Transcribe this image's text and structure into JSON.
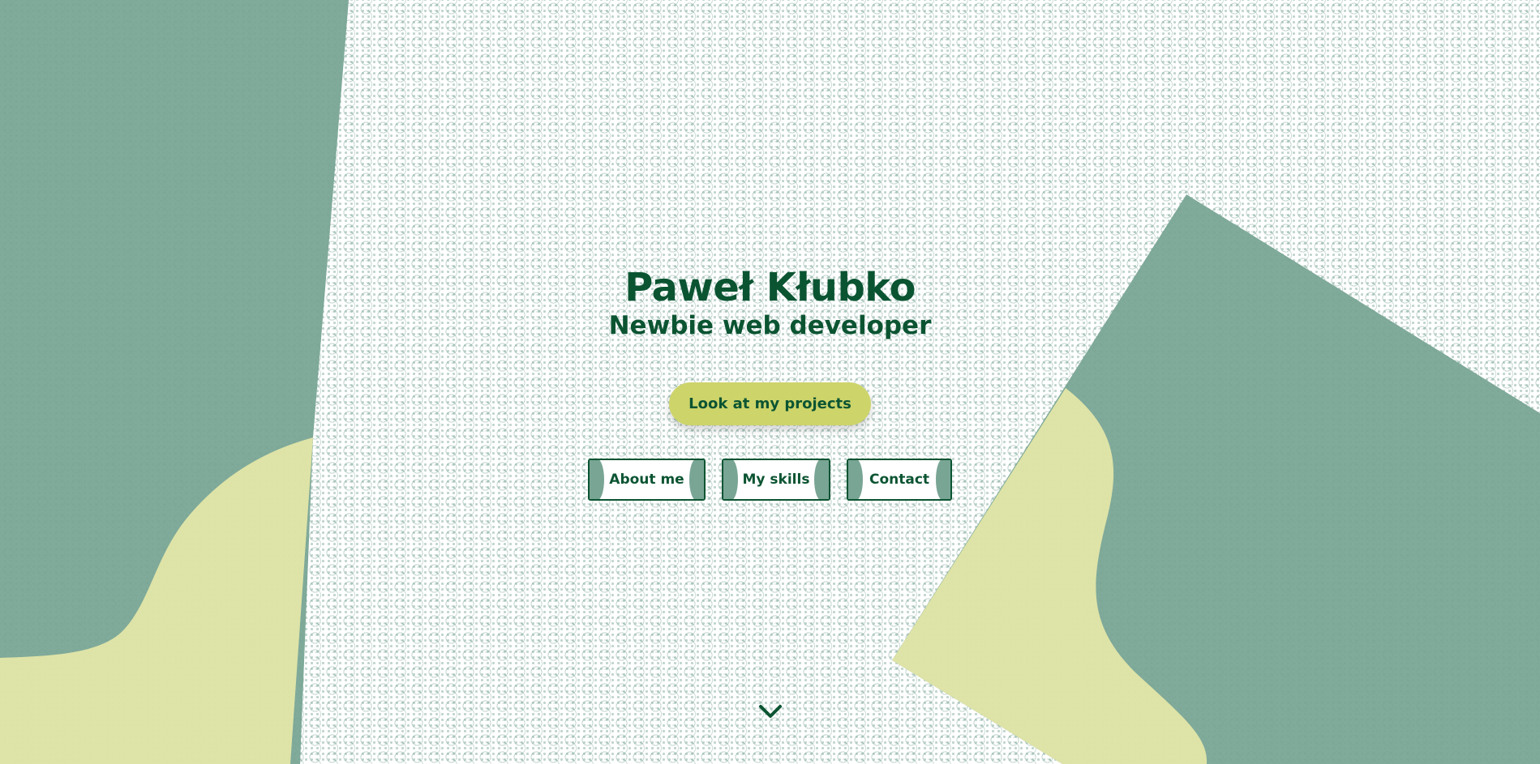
{
  "hero": {
    "name": "Paweł Kłubko",
    "tagline": "Newbie web developer",
    "cta_label": "Look at my projects"
  },
  "nav": {
    "about_label": "About me",
    "skills_label": "My skills",
    "contact_label": "Contact"
  },
  "icons": {
    "scroll": "chevron-down-icon"
  },
  "colors": {
    "primary_dark": "#0b5432",
    "shape_green": "#79a595",
    "shape_yellow": "#e3e6a8",
    "accent_yellow": "#cdd46a"
  }
}
